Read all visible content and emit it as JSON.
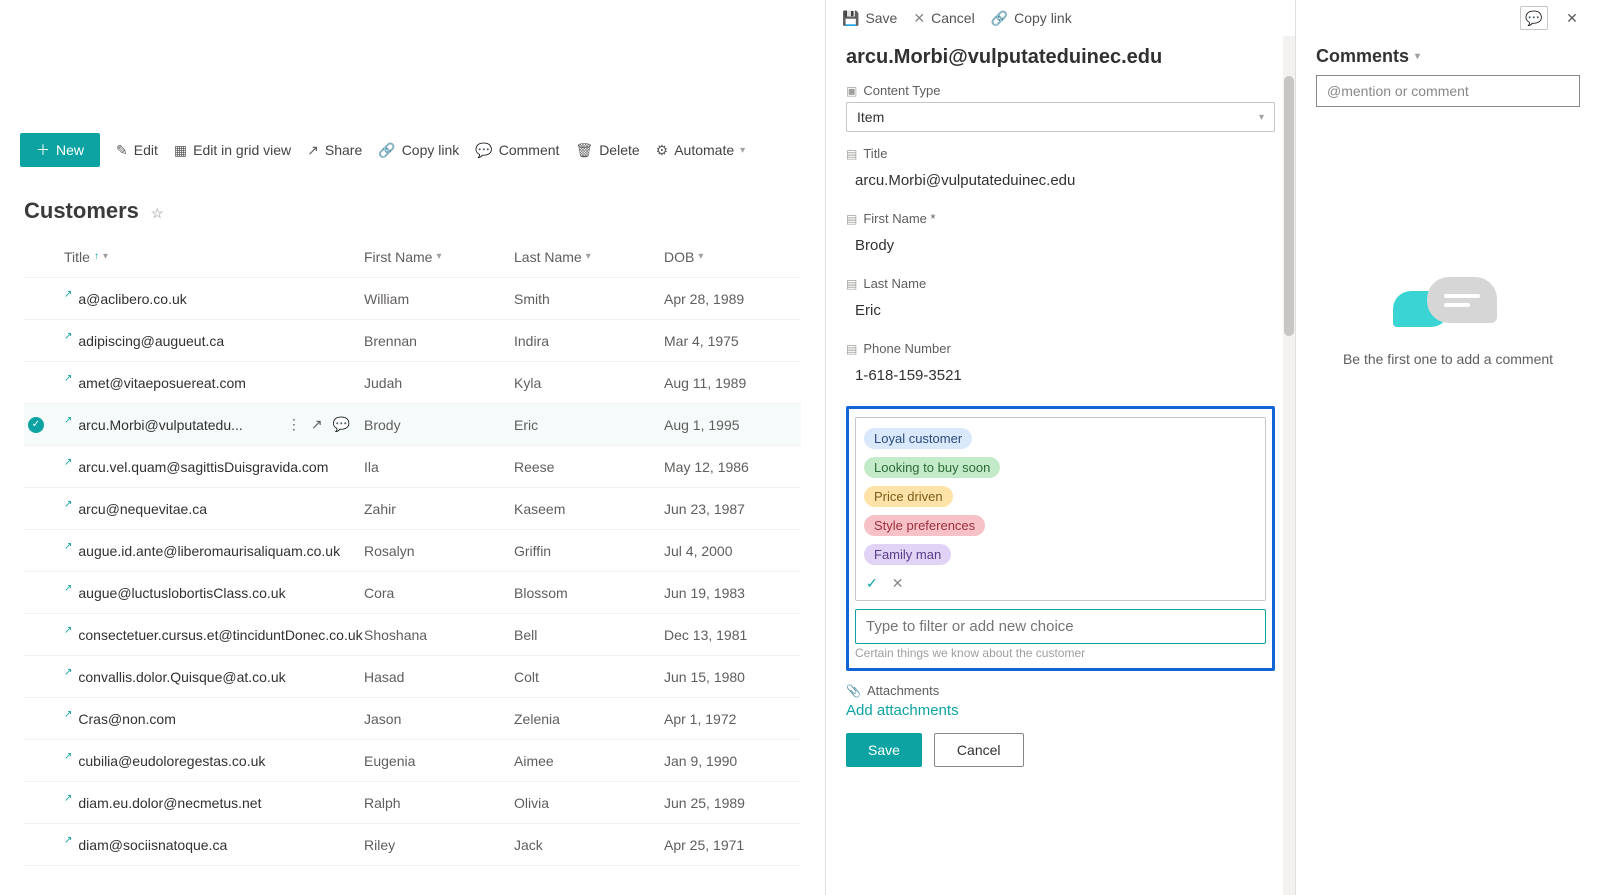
{
  "toolbar": {
    "new": "New",
    "edit": "Edit",
    "grid": "Edit in grid view",
    "share": "Share",
    "copy_link": "Copy link",
    "comment": "Comment",
    "delete": "Delete",
    "automate": "Automate"
  },
  "list": {
    "title": "Customers",
    "columns": {
      "title": "Title",
      "first_name": "First Name",
      "last_name": "Last Name",
      "dob": "DOB"
    },
    "rows": [
      {
        "title": "a@aclibero.co.uk",
        "first": "William",
        "last": "Smith",
        "dob": "Apr 28, 1989"
      },
      {
        "title": "adipiscing@augueut.ca",
        "first": "Brennan",
        "last": "Indira",
        "dob": "Mar 4, 1975"
      },
      {
        "title": "amet@vitaeposuereat.com",
        "first": "Judah",
        "last": "Kyla",
        "dob": "Aug 11, 1989"
      },
      {
        "title": "arcu.Morbi@vulputatedu...",
        "first": "Brody",
        "last": "Eric",
        "dob": "Aug 1, 1995",
        "selected": true
      },
      {
        "title": "arcu.vel.quam@sagittisDuisgravida.com",
        "first": "Ila",
        "last": "Reese",
        "dob": "May 12, 1986"
      },
      {
        "title": "arcu@nequevitae.ca",
        "first": "Zahir",
        "last": "Kaseem",
        "dob": "Jun 23, 1987"
      },
      {
        "title": "augue.id.ante@liberomaurisaliquam.co.uk",
        "first": "Rosalyn",
        "last": "Griffin",
        "dob": "Jul 4, 2000"
      },
      {
        "title": "augue@luctuslobortisClass.co.uk",
        "first": "Cora",
        "last": "Blossom",
        "dob": "Jun 19, 1983"
      },
      {
        "title": "consectetuer.cursus.et@tinciduntDonec.co.uk",
        "first": "Shoshana",
        "last": "Bell",
        "dob": "Dec 13, 1981"
      },
      {
        "title": "convallis.dolor.Quisque@at.co.uk",
        "first": "Hasad",
        "last": "Colt",
        "dob": "Jun 15, 1980"
      },
      {
        "title": "Cras@non.com",
        "first": "Jason",
        "last": "Zelenia",
        "dob": "Apr 1, 1972"
      },
      {
        "title": "cubilia@eudoloregestas.co.uk",
        "first": "Eugenia",
        "last": "Aimee",
        "dob": "Jan 9, 1990"
      },
      {
        "title": "diam.eu.dolor@necmetus.net",
        "first": "Ralph",
        "last": "Olivia",
        "dob": "Jun 25, 1989"
      },
      {
        "title": "diam@sociisnatoque.ca",
        "first": "Riley",
        "last": "Jack",
        "dob": "Apr 25, 1971"
      }
    ]
  },
  "panel": {
    "actions": {
      "save": "Save",
      "cancel": "Cancel",
      "copy_link": "Copy link"
    },
    "item_title": "arcu.Morbi@vulputateduinec.edu",
    "fields": {
      "content_type_label": "Content Type",
      "content_type_value": "Item",
      "title_label": "Title",
      "title_value": "arcu.Morbi@vulputateduinec.edu",
      "first_name_label": "First Name *",
      "first_name_value": "Brody",
      "last_name_label": "Last Name",
      "last_name_value": "Eric",
      "phone_label": "Phone Number",
      "phone_value": "1-618-159-3521",
      "attachments_label": "Attachments",
      "add_attachments": "Add attachments"
    },
    "choices": {
      "items": [
        "Loyal customer",
        "Looking to buy soon",
        "Price driven",
        "Style preferences",
        "Family man"
      ],
      "filter_placeholder": "Type to filter or add new choice",
      "helper": "Certain things we know about the customer"
    },
    "buttons": {
      "save": "Save",
      "cancel": "Cancel"
    }
  },
  "comments": {
    "heading": "Comments",
    "placeholder": "@mention or comment",
    "empty": "Be the first one to add a comment"
  },
  "colors": {
    "accent": "#0da3a3",
    "highlight_border": "#1265d6"
  }
}
